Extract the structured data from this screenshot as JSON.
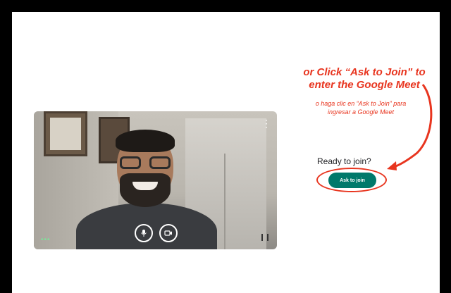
{
  "annotation": {
    "title_line1": "or Click “Ask to Join” to",
    "title_line2": "enter the Google Meet",
    "subtitle_line1": "o haga clic en “Ask to Join” para",
    "subtitle_line2": "ingresar a Google Meet",
    "color": "#e8351f"
  },
  "join_panel": {
    "ready_text": "Ready to join?",
    "button_label": "Ask to join",
    "button_color": "#00796b"
  },
  "video": {
    "menu_icon": "more-vert-icon",
    "mic_icon": "microphone-icon",
    "camera_icon": "camera-icon",
    "status_dots": "•••"
  }
}
